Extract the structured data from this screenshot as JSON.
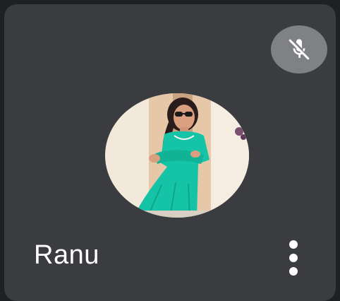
{
  "participant": {
    "name": "Ranu",
    "mic_status_icon": "mic-off-icon",
    "more_options_icon": "more-vert-icon"
  },
  "colors": {
    "tile_background": "#3b3c40",
    "page_background": "#1f2023",
    "mute_badge": "#7f8185",
    "name_text": "#ffffff"
  }
}
